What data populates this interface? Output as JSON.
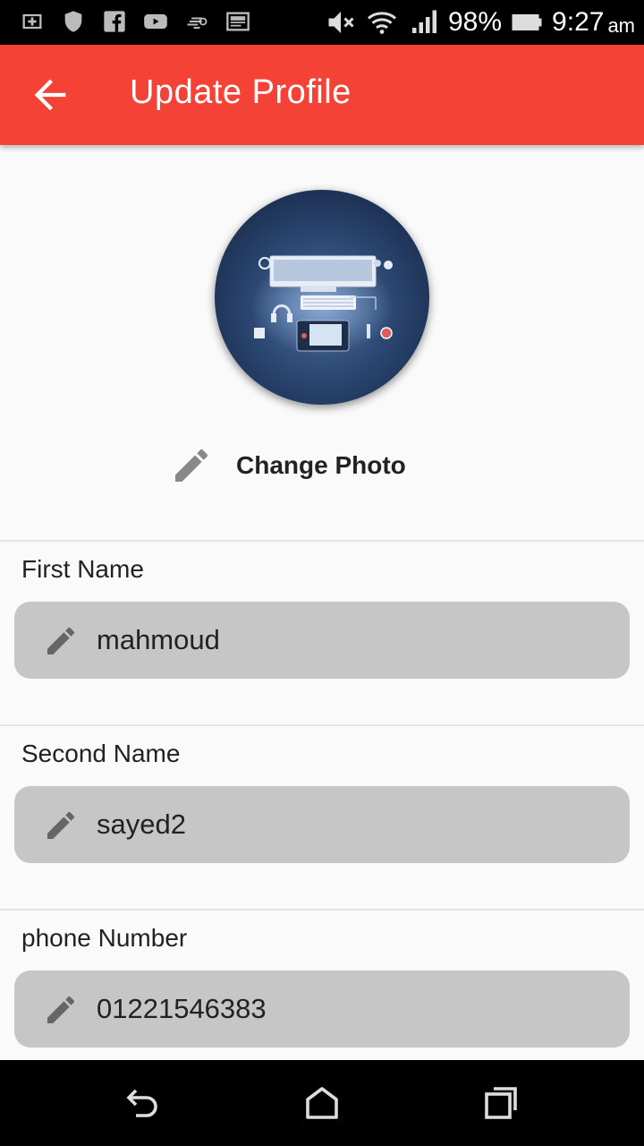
{
  "status_bar": {
    "battery": "98%",
    "time": "9:27",
    "ampm": "am",
    "left_icons": [
      "add-box-icon",
      "shield-icon",
      "facebook-icon",
      "youtube-icon",
      "speed-app-icon",
      "image-icon"
    ],
    "right_icons": [
      "muted-icon",
      "wifi-icon",
      "signal-icon",
      "battery-icon"
    ]
  },
  "app_bar": {
    "title": "Update Profile",
    "back_icon": "arrow-back-icon",
    "color": "#f44336"
  },
  "profile": {
    "change_photo_label": "Change Photo",
    "edit_icon": "pencil-icon"
  },
  "fields": [
    {
      "label": "First Name",
      "value": "mahmoud"
    },
    {
      "label": "Second Name",
      "value": "sayed2"
    },
    {
      "label": "phone Number",
      "value": "01221546383"
    }
  ],
  "nav_bar": {
    "icons": [
      "back-nav-icon",
      "home-nav-icon",
      "recents-nav-icon"
    ]
  }
}
